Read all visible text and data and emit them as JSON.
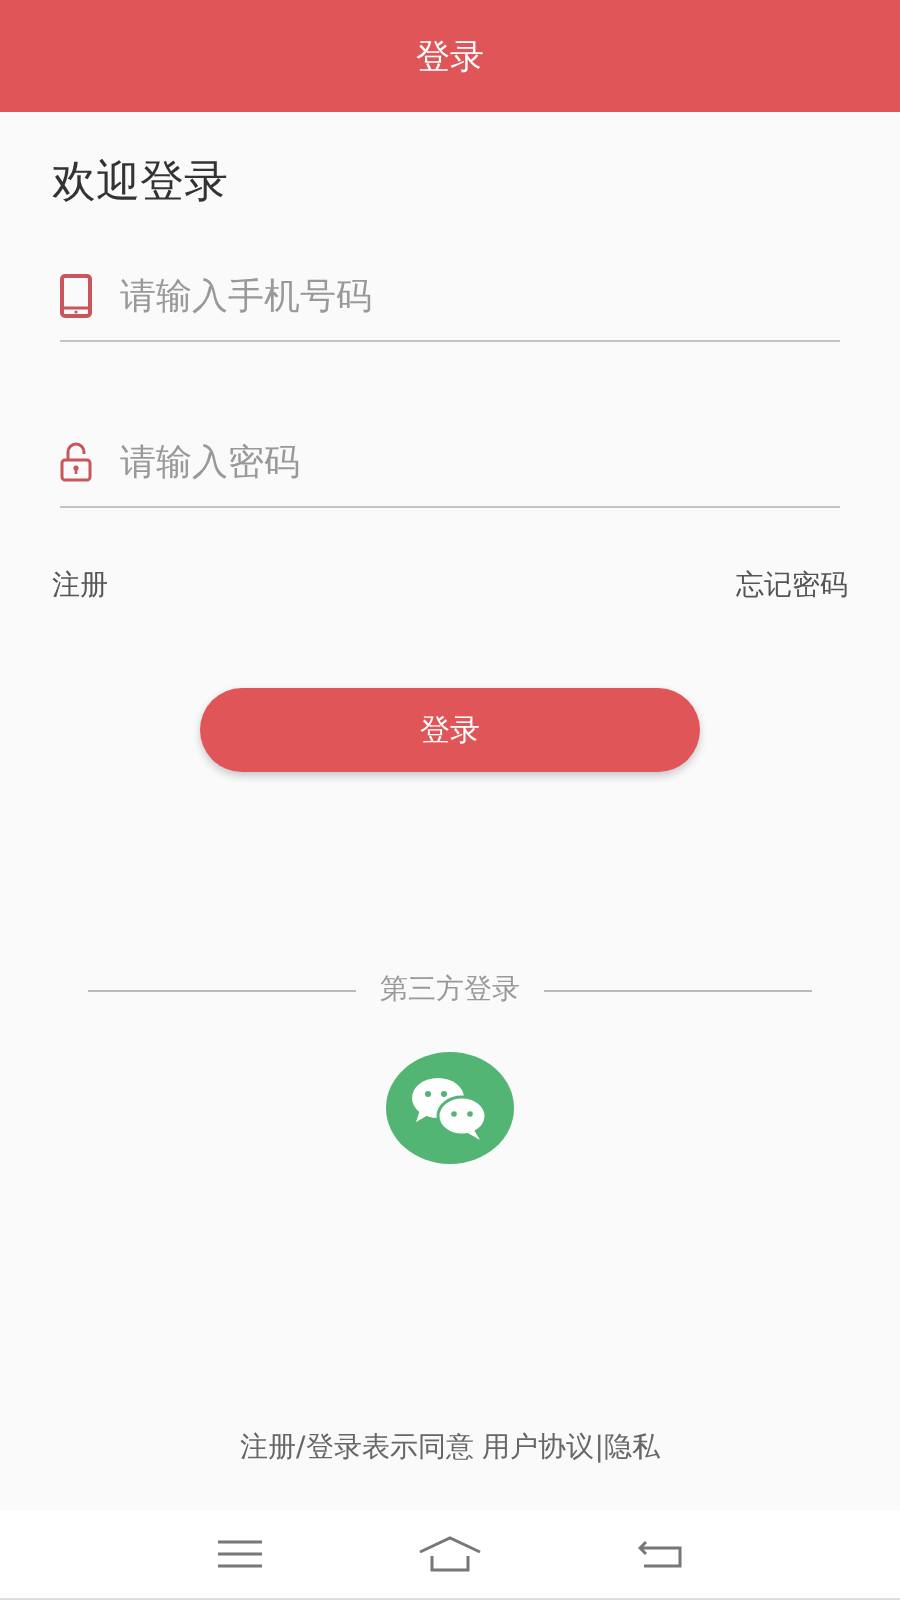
{
  "header": {
    "title": "登录"
  },
  "heading": "欢迎登录",
  "fields": [
    {
      "kind": "phone",
      "placeholder": "请输入手机号码"
    },
    {
      "kind": "password",
      "placeholder": "请输入密码"
    }
  ],
  "links": {
    "register": "注册",
    "forgot": "忘记密码"
  },
  "login_button": "登录",
  "third_party": {
    "label": "第三方登录"
  },
  "agreement": "注册/登录表示同意 用户协议|隐私"
}
